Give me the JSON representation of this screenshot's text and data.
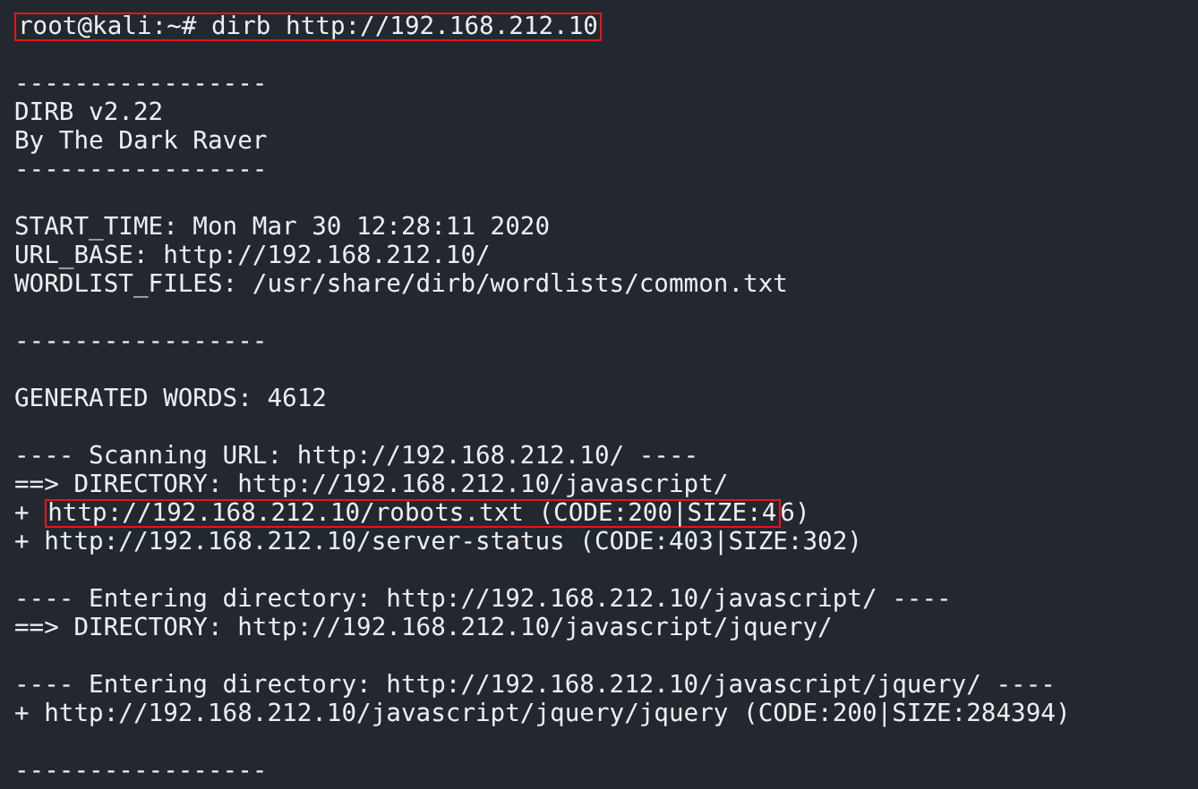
{
  "terminal": {
    "lines": [
      {
        "kind": "prompt",
        "prompt": "root@kali:~#",
        "command": " dirb http://192.168.212.10",
        "marked": true
      },
      {
        "kind": "blank"
      },
      {
        "kind": "output",
        "text": "-----------------"
      },
      {
        "kind": "output",
        "text": "DIRB v2.22"
      },
      {
        "kind": "output",
        "text": "By The Dark Raver"
      },
      {
        "kind": "output",
        "text": "-----------------"
      },
      {
        "kind": "blank"
      },
      {
        "kind": "output",
        "text": "START_TIME: Mon Mar 30 12:28:11 2020"
      },
      {
        "kind": "output",
        "text": "URL_BASE: http://192.168.212.10/"
      },
      {
        "kind": "output",
        "text": "WORDLIST_FILES: /usr/share/dirb/wordlists/common.txt"
      },
      {
        "kind": "blank"
      },
      {
        "kind": "output",
        "text": "-----------------"
      },
      {
        "kind": "blank"
      },
      {
        "kind": "output",
        "text": "GENERATED WORDS: 4612"
      },
      {
        "kind": "blank"
      },
      {
        "kind": "output",
        "text": "---- Scanning URL: http://192.168.212.10/ ----"
      },
      {
        "kind": "output",
        "text": "==> DIRECTORY: http://192.168.212.10/javascript/"
      },
      {
        "kind": "marked",
        "before": "+ ",
        "marked": "http://192.168.212.10/robots.txt (CODE:200|SIZE:4",
        "after": "6)"
      },
      {
        "kind": "output",
        "text": "+ http://192.168.212.10/server-status (CODE:403|SIZE:302)"
      },
      {
        "kind": "blank"
      },
      {
        "kind": "output",
        "text": "---- Entering directory: http://192.168.212.10/javascript/ ----"
      },
      {
        "kind": "output",
        "text": "==> DIRECTORY: http://192.168.212.10/javascript/jquery/"
      },
      {
        "kind": "blank"
      },
      {
        "kind": "output",
        "text": "---- Entering directory: http://192.168.212.10/javascript/jquery/ ----"
      },
      {
        "kind": "output",
        "text": "+ http://192.168.212.10/javascript/jquery/jquery (CODE:200|SIZE:284394)"
      },
      {
        "kind": "blank"
      },
      {
        "kind": "output",
        "text": "-----------------"
      }
    ]
  }
}
